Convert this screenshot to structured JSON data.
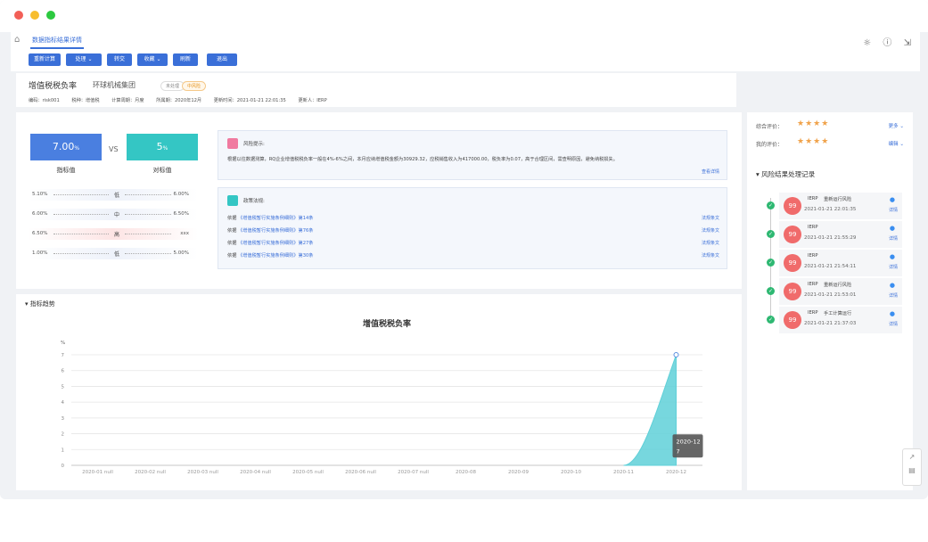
{
  "window": {
    "dots": [
      "#f25f57",
      "#f7bd2e",
      "#2cc940"
    ]
  },
  "nav": {
    "tab": "数据指标结果详情",
    "icons": [
      "sun-icon",
      "help-icon",
      "collapse-icon"
    ]
  },
  "toolbar": {
    "buttons": [
      {
        "label": "重新计算",
        "dropdown": false
      },
      {
        "label": "处理",
        "dropdown": true
      },
      {
        "label": "转交",
        "dropdown": false
      },
      {
        "label": "收藏",
        "dropdown": true
      },
      {
        "label": "刷新",
        "dropdown": false
      },
      {
        "label": "退出",
        "dropdown": false
      }
    ]
  },
  "info": {
    "title": "增值税税负率",
    "company": "环球机械集团",
    "tag_gray": "未处理",
    "tag_orange": "中风险",
    "meta": [
      "编码：risk001",
      "税种：增值税",
      "计算周期：月度",
      "所属期：2020年12月",
      "更新时间：2021-01-21 22:01:35",
      "更新人：IERP"
    ]
  },
  "metric": {
    "indicator_value": "7.00",
    "indicator_unit": "%",
    "indicator_label": "指标值",
    "vs": "VS",
    "benchmark_value": "5",
    "benchmark_unit": "%",
    "benchmark_label": "对标值",
    "ranges": [
      {
        "from": "5.10%",
        "level": "低",
        "to": "6.00%",
        "bg": "#eef2fa"
      },
      {
        "from": "6.00%",
        "level": "中",
        "to": "6.50%",
        "bg": "#eef2fa"
      },
      {
        "from": "6.50%",
        "level": "高",
        "to": "xxx",
        "bg": "#fde4e4"
      },
      {
        "from": "1.00%",
        "level": "低",
        "to": "5.00%",
        "bg": "#eef2fa"
      }
    ]
  },
  "risk": {
    "title": "风险提示:",
    "text": "根据以往数据测算，RQ企业增值税税负率一般在4%-6%之间，本月应纳增值税金额为30929.32，应税销售收入为417000.00，税负率为0.07，高于合理区间，需查明原因，避免纳税损失。",
    "link": "查看详情"
  },
  "policy": {
    "title": "政策法规:",
    "items": [
      {
        "prefix": "依据",
        "law": "《增值税暂行实施条例细则》",
        "clause": "第14条",
        "link": "法规条文"
      },
      {
        "prefix": "依据",
        "law": "《增值税暂行实施条例细则》",
        "clause": "第76条",
        "link": "法规条文"
      },
      {
        "prefix": "依据",
        "law": "《增值税暂行实施条例细则》",
        "clause": "第27条",
        "link": "法规条文"
      },
      {
        "prefix": "依据",
        "law": "《增值税暂行实施条例细则》",
        "clause": "第30条",
        "link": "法规条文"
      }
    ]
  },
  "trend": {
    "header": "指标趋势"
  },
  "chart_data": {
    "type": "area",
    "title": "增值税税负率",
    "ylabel": "%",
    "ylim": [
      0,
      7
    ],
    "yticks": [
      0,
      1,
      2,
      3,
      4,
      5,
      6,
      7
    ],
    "categories": [
      "2020-01 null",
      "2020-02 null",
      "2020-03 null",
      "2020-04 null",
      "2020-05 null",
      "2020-06 null",
      "2020-07 null",
      "2020-08",
      "2020-09",
      "2020-10",
      "2020-11",
      "2020-12"
    ],
    "values": [
      0,
      0,
      0,
      0,
      0,
      0,
      0,
      0,
      0,
      0,
      0,
      7
    ],
    "tooltip": {
      "line1": "2020-12",
      "line2": "7"
    },
    "color": "#5fd0d8",
    "grid": true
  },
  "rating": {
    "overall_label": "综合评价：",
    "overall_stars": "★★★★",
    "overall_more": "更多",
    "my_label": "我的评价：",
    "my_stars": "★★★★",
    "my_more": "编辑"
  },
  "records": {
    "title": "风险结果处理记录",
    "items": [
      {
        "avatar": "99",
        "user": "IERP",
        "action": "重新运行风险",
        "time": "2021-01-21 22:01:35",
        "detail": "详情"
      },
      {
        "avatar": "99",
        "user": "IERP",
        "action": "",
        "time": "2021-01-21 21:55:29",
        "detail": "详情"
      },
      {
        "avatar": "99",
        "user": "IERP",
        "action": "",
        "time": "2021-01-21 21:54:11",
        "detail": "详情"
      },
      {
        "avatar": "99",
        "user": "IERP",
        "action": "重新运行风险",
        "time": "2021-01-21 21:53:01",
        "detail": "详情"
      },
      {
        "avatar": "99",
        "user": "IERP",
        "action": "手工计算运行",
        "time": "2021-01-21 21:37:03",
        "detail": "详情"
      }
    ]
  }
}
